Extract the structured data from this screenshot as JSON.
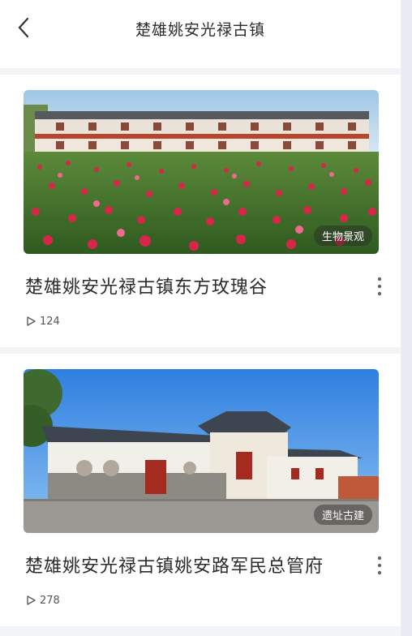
{
  "header": {
    "title": "楚雄姚安光禄古镇",
    "back_icon": "chevron-left-icon"
  },
  "videos": [
    {
      "title": "楚雄姚安光禄古镇东方玫瑰谷",
      "tag": "生物景观",
      "plays": "124"
    },
    {
      "title": "楚雄姚安光禄古镇姚安路军民总管府",
      "tag": "遗址古建",
      "plays": "278"
    }
  ],
  "colors": {
    "background": "#f3f4f6",
    "card": "#ffffff",
    "text": "#2b2b2b"
  }
}
